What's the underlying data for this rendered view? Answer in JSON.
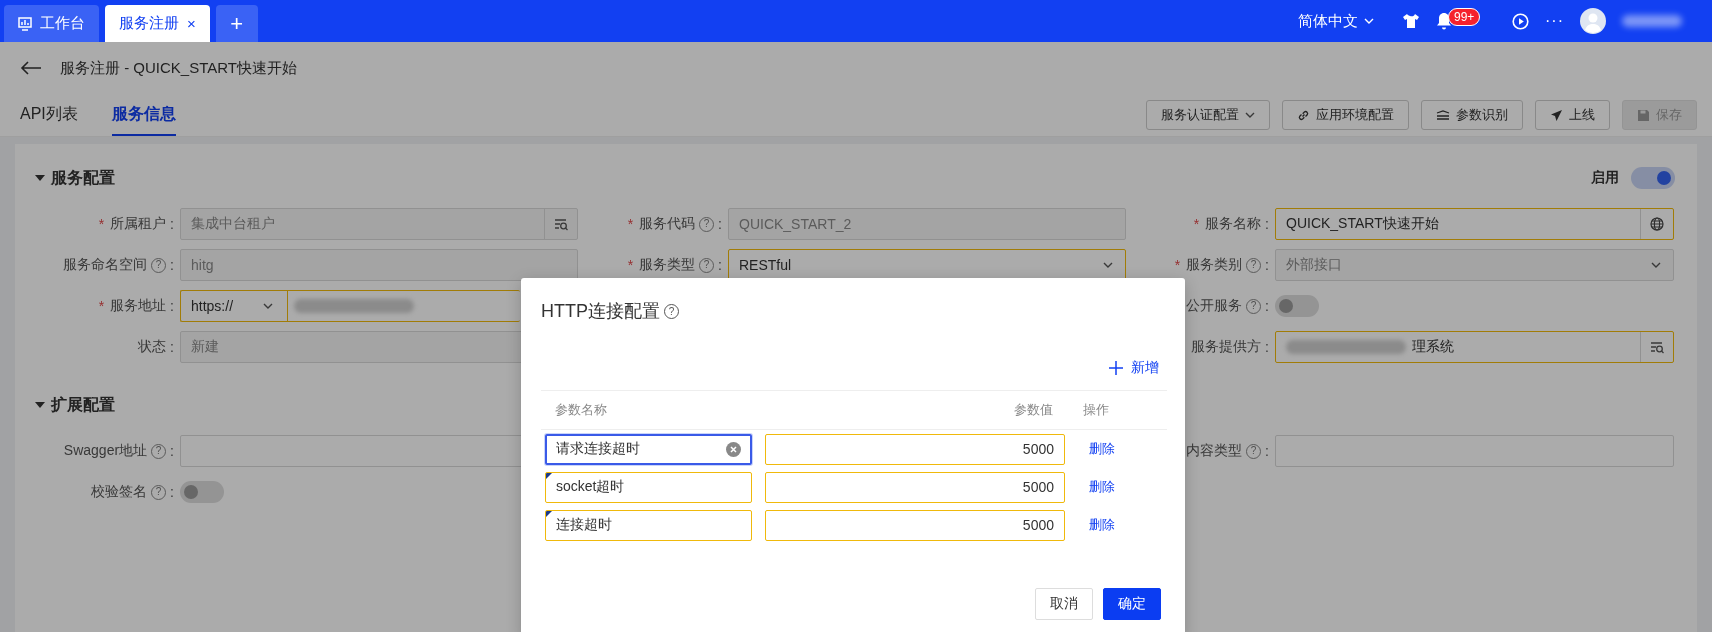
{
  "top_bar": {
    "tabs": [
      {
        "label": "工作台",
        "kind": "home",
        "selected": false
      },
      {
        "label": "服务注册",
        "kind": "page",
        "selected": true,
        "close": "×"
      }
    ],
    "add_tab": "+",
    "language": "简体中文",
    "notification_badge": "99+",
    "more": "···"
  },
  "header": {
    "title": "服务注册 - QUICK_START快速开始",
    "tabs": [
      {
        "label": "API列表",
        "selected": false
      },
      {
        "label": "服务信息",
        "selected": true
      }
    ],
    "actions": [
      {
        "label": "服务认证配置",
        "kind": "dropdown",
        "disabled": false
      },
      {
        "label": "应用环境配置",
        "kind": "link",
        "disabled": false
      },
      {
        "label": "参数识别",
        "kind": "scan",
        "disabled": false
      },
      {
        "label": "上线",
        "kind": "send",
        "disabled": false
      },
      {
        "label": "保存",
        "kind": "save",
        "disabled": true
      }
    ]
  },
  "sections": [
    {
      "title": "服务配置",
      "expanded": true,
      "switch": {
        "label": "启用",
        "on": true
      },
      "rows": [
        {
          "left": {
            "required": "*",
            "label": "所属租户",
            "colon": ":",
            "kind": "lookup",
            "value": "集成中台租户",
            "disabled": true,
            "highlighted": false
          },
          "middle": {
            "required": "*",
            "label": "服务代码",
            "help": "?",
            "colon": ":",
            "kind": "input",
            "value": "QUICK_START_2",
            "disabled": true,
            "highlighted": false
          },
          "right": {
            "required": "*",
            "label": "服务名称",
            "colon": ":",
            "kind": "globe",
            "value": "QUICK_START快速开始",
            "disabled": false,
            "highlighted": true
          }
        },
        {
          "left": {
            "label": "服务命名空间",
            "help": "?",
            "colon": ":",
            "kind": "input",
            "value": "hitg",
            "disabled": true,
            "highlighted": false
          },
          "middle": {
            "required": "*",
            "label": "服务类型",
            "help": "?",
            "colon": ":",
            "kind": "select",
            "value": "RESTful",
            "disabled": false,
            "highlighted": true
          },
          "right": {
            "required": "*",
            "label": "服务类别",
            "help": "?",
            "colon": ":",
            "kind": "select",
            "value": "外部接口",
            "disabled": true,
            "highlighted": false
          }
        },
        {
          "left": {
            "required": "*",
            "label": "服务地址",
            "colon": ":",
            "kind": "url",
            "protocol": "https://",
            "redacted": true,
            "disabled": false,
            "highlighted": true
          },
          "right": {
            "label": "公开服务",
            "help": "?",
            "colon": ":",
            "kind": "toggle",
            "on": false
          }
        },
        {
          "left": {
            "label": "状态",
            "colon": ":",
            "kind": "input",
            "value": "新建",
            "disabled": true,
            "highlighted": false
          },
          "right": {
            "label": "服务提供方",
            "colon": ":",
            "kind": "lookup",
            "value": "理系统",
            "redacted": true,
            "disabled": false,
            "highlighted": true
          }
        }
      ]
    },
    {
      "title": "扩展配置",
      "expanded": true,
      "rows": [
        {
          "left": {
            "label": "Swagger地址",
            "help": "?",
            "colon": ":",
            "kind": "input",
            "disabled": false,
            "highlighted": false
          },
          "right": {
            "label": "内容类型",
            "help": "?",
            "colon": ":",
            "kind": "input",
            "disabled": false,
            "highlighted": false
          }
        },
        {
          "left": {
            "label": "校验签名",
            "help": "?",
            "colon": ":",
            "kind": "toggle",
            "on": false
          }
        }
      ]
    }
  ],
  "dialog": {
    "title": "HTTP连接配置",
    "help": "?",
    "add": "新增",
    "columns": [
      "参数名称",
      "参数值",
      "操作"
    ],
    "rows": [
      {
        "name": "请求连接超时",
        "value": "5000",
        "action": "删除",
        "focused": true,
        "modified": false
      },
      {
        "name": "socket超时",
        "value": "5000",
        "action": "删除",
        "focused": false,
        "modified": true
      },
      {
        "name": "连接超时",
        "value": "5000",
        "action": "删除",
        "focused": false,
        "modified": true
      }
    ],
    "buttons": [
      {
        "label": "取消",
        "primary": false
      },
      {
        "label": "确定",
        "primary": true
      }
    ]
  }
}
